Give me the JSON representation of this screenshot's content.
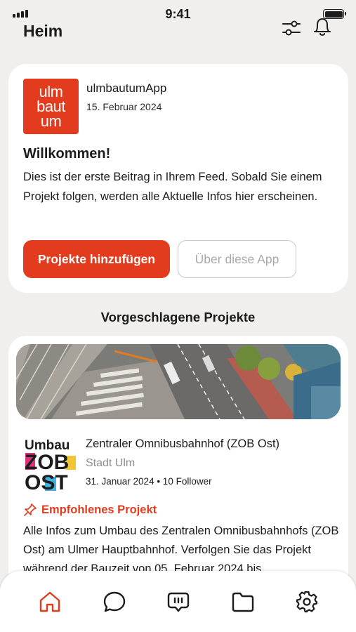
{
  "status": {
    "time": "9:41"
  },
  "header": {
    "title": "Heim",
    "filter_icon": "sliders-icon",
    "bell_icon": "bell-icon"
  },
  "post": {
    "logo_lines": [
      "ulm",
      "baut",
      "um"
    ],
    "app_name": "ulmbautumApp",
    "date": "15. Februar 2024",
    "title": "Willkommen!",
    "text": "Dies ist der erste Beitrag in Ihrem Feed. Sobald Sie einem Projekt folgen, werden alle Aktuelle Infos hier erscheinen.",
    "primary_button": "Projekte hinzufügen",
    "secondary_button": "Über diese App"
  },
  "suggested": {
    "section_title": "Vorgeschlagene Projekte",
    "project": {
      "logo_words": [
        "Umbau",
        "ZOB",
        "OST"
      ],
      "title": "Zentraler Omnibusbahnhof (ZOB Ost)",
      "org": "Stadt Ulm",
      "meta": "31. Januar 2024 • 10 Follower",
      "recommended_label": "Empfohlenes Projekt",
      "description": "Alle Infos zum Umbau des Zentralen Omnibusbahnhofs (ZOB Ost) am Ulmer Hauptbahnhof. Verfolgen Sie das Projekt während der Bauzeit von 05. Februar 2024 bis"
    }
  },
  "tabs": [
    {
      "name": "home",
      "icon": "home-icon",
      "active": true
    },
    {
      "name": "chat",
      "icon": "chat-bubble-icon"
    },
    {
      "name": "messages",
      "icon": "message-dots-icon"
    },
    {
      "name": "folder",
      "icon": "folder-icon"
    },
    {
      "name": "settings",
      "icon": "gear-icon"
    }
  ],
  "colors": {
    "accent": "#e23b1d",
    "background": "#f0efee",
    "card": "#ffffff"
  }
}
